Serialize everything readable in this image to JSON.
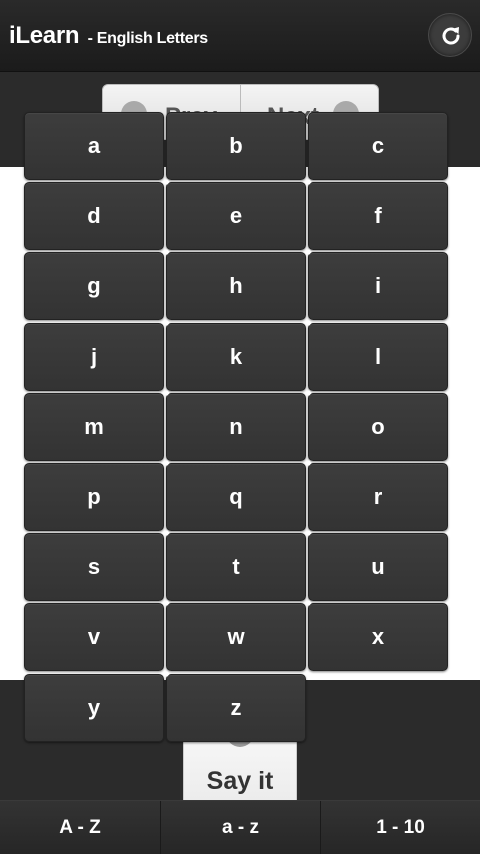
{
  "header": {
    "title": "iLearn",
    "subtitle": "- English Letters",
    "refresh_icon": "refresh-icon"
  },
  "toolbar": {
    "prev_label": "Prev",
    "next_label": "Next",
    "prev_icon": "chevron-left-icon",
    "next_icon": "chevron-right-icon"
  },
  "say_it": {
    "label": "Say it",
    "icon": "play-icon"
  },
  "letters": [
    "a",
    "b",
    "c",
    "d",
    "e",
    "f",
    "g",
    "h",
    "i",
    "j",
    "k",
    "l",
    "m",
    "n",
    "o",
    "p",
    "q",
    "r",
    "s",
    "t",
    "u",
    "v",
    "w",
    "x",
    "y",
    "z"
  ],
  "tabs": [
    {
      "label": "A - Z"
    },
    {
      "label": "a - z"
    },
    {
      "label": "1 - 10"
    }
  ],
  "colors": {
    "header_bg": "#1f1f1f",
    "key_bg": "#383838",
    "key_text": "#ffffff",
    "content_bg": "#ffffff"
  }
}
